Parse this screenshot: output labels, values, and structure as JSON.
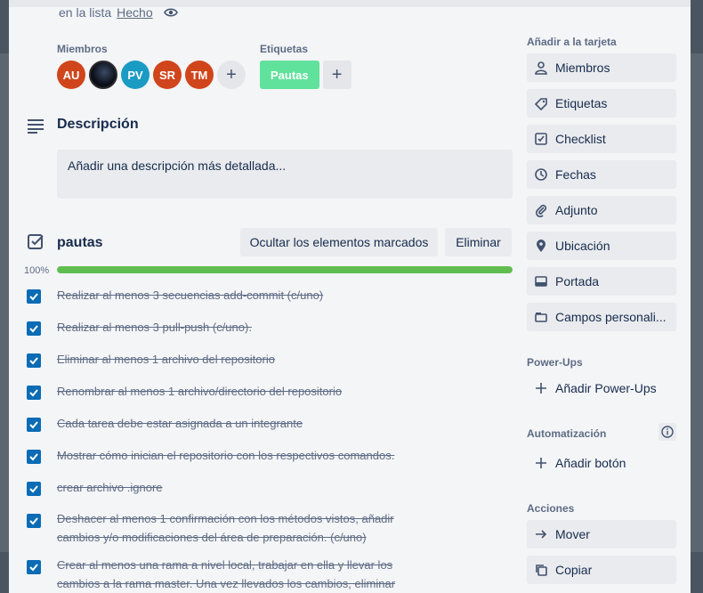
{
  "card": {
    "in_list_prefix": "en la lista",
    "list_name": "Hecho"
  },
  "members": {
    "title": "Miembros",
    "avatars": [
      {
        "initials": "AU",
        "color": "#d0451b"
      },
      {
        "initials": "",
        "color": "#0b0f18"
      },
      {
        "initials": "PV",
        "color": "#1a9bc4"
      },
      {
        "initials": "SR",
        "color": "#d0451b"
      },
      {
        "initials": "TM",
        "color": "#d0451b"
      }
    ],
    "add": "+"
  },
  "labels": {
    "title": "Etiquetas",
    "items": [
      {
        "text": "Pautas",
        "color": "#61e29c"
      }
    ],
    "add": "+"
  },
  "description": {
    "title": "Descripción",
    "placeholder": "Añadir una descripción más detallada..."
  },
  "checklist": {
    "title": "pautas",
    "hide_button": "Ocultar los elementos marcados",
    "delete_button": "Eliminar",
    "progress_label": "100%",
    "progress": 1.0,
    "items": [
      {
        "lines": [
          "Realizar al menos 3 secuencias add-commit (c/uno)"
        ],
        "checked": true
      },
      {
        "lines": [
          "Realizar al menos 3 pull-push (c/uno)."
        ],
        "checked": true
      },
      {
        "lines": [
          "Eliminar al menos 1 archivo del repositorio"
        ],
        "checked": true
      },
      {
        "lines": [
          "Renombrar al menos 1 archivo/directorio del repositorio"
        ],
        "checked": true
      },
      {
        "lines": [
          "Cada tarea debe estar asignada a un integrante"
        ],
        "checked": true
      },
      {
        "lines": [
          "Mostrar cómo inician el repositorio con los respectivos comandos."
        ],
        "checked": true
      },
      {
        "lines": [
          "crear archivo .ignore"
        ],
        "checked": true
      },
      {
        "lines": [
          "Deshacer al menos 1 confirmación con los métodos vistos, añadir",
          "cambios y/o modificaciones del área de preparación. (c/uno)"
        ],
        "checked": true
      },
      {
        "lines": [
          "Crear al menos una rama a nivel local, trabajar en ella y llevar los",
          "cambios a la rama master. Una vez llevados los cambios, eliminar"
        ],
        "checked": true
      }
    ]
  },
  "sidebar": {
    "add_to_card_title": "Añadir a la tarjeta",
    "add_to_card": [
      {
        "label": "Miembros",
        "icon": "person-icon"
      },
      {
        "label": "Etiquetas",
        "icon": "tag-icon"
      },
      {
        "label": "Checklist",
        "icon": "checklist-icon"
      },
      {
        "label": "Fechas",
        "icon": "clock-icon"
      },
      {
        "label": "Adjunto",
        "icon": "paperclip-icon"
      },
      {
        "label": "Ubicación",
        "icon": "pin-icon"
      },
      {
        "label": "Portada",
        "icon": "cover-icon"
      },
      {
        "label": "Campos personali...",
        "icon": "custom-fields-icon"
      }
    ],
    "powerups_title": "Power-Ups",
    "add_powerups": "Añadir Power-Ups",
    "automation_title": "Automatización",
    "add_button": "Añadir botón",
    "actions_title": "Acciones",
    "actions": [
      {
        "label": "Mover",
        "icon": "arrow-right-icon"
      },
      {
        "label": "Copiar",
        "icon": "copy-icon"
      }
    ]
  }
}
